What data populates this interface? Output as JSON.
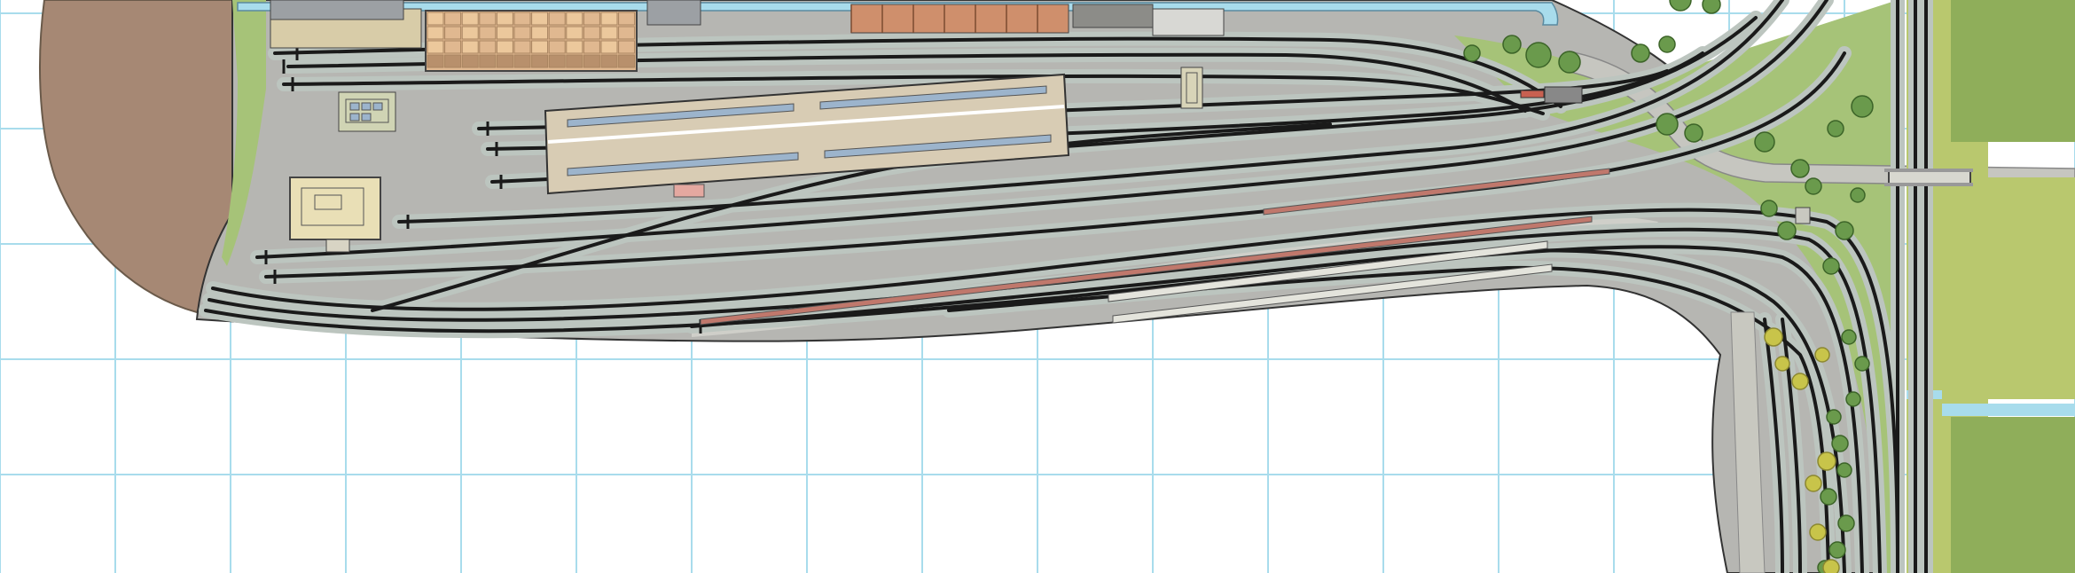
{
  "colors": {
    "grid_line": "#a8dcec",
    "paper": "#ffffff",
    "turntable_pit": "#a68874",
    "baseboard": "#b6b6b2",
    "ballast": "#bcc5bf",
    "rail": "#1a1a1a",
    "grass": "#a6c378",
    "field": "#b9c86e",
    "field_dark": "#8fae5a",
    "tree": "#6a9a4c",
    "road": "#c6c6c0",
    "water": "#a8dcec",
    "station_roof": "#d8ccb4",
    "roof_glass": "#9cb4cc",
    "warehouse": "#e0b890",
    "warehouse_grid": "#a88460",
    "building_beige": "#e9dfb6",
    "platform_red": "#c0786c",
    "wagon": "#cf8f6c"
  },
  "layers": {
    "grid": "grid-paper",
    "turntable": "turntable-pit",
    "yard": "yard-baseboard",
    "station": "station-building",
    "warehouse": "goods-warehouse",
    "bridge": "road-bridge",
    "fields": "farm-fields"
  }
}
